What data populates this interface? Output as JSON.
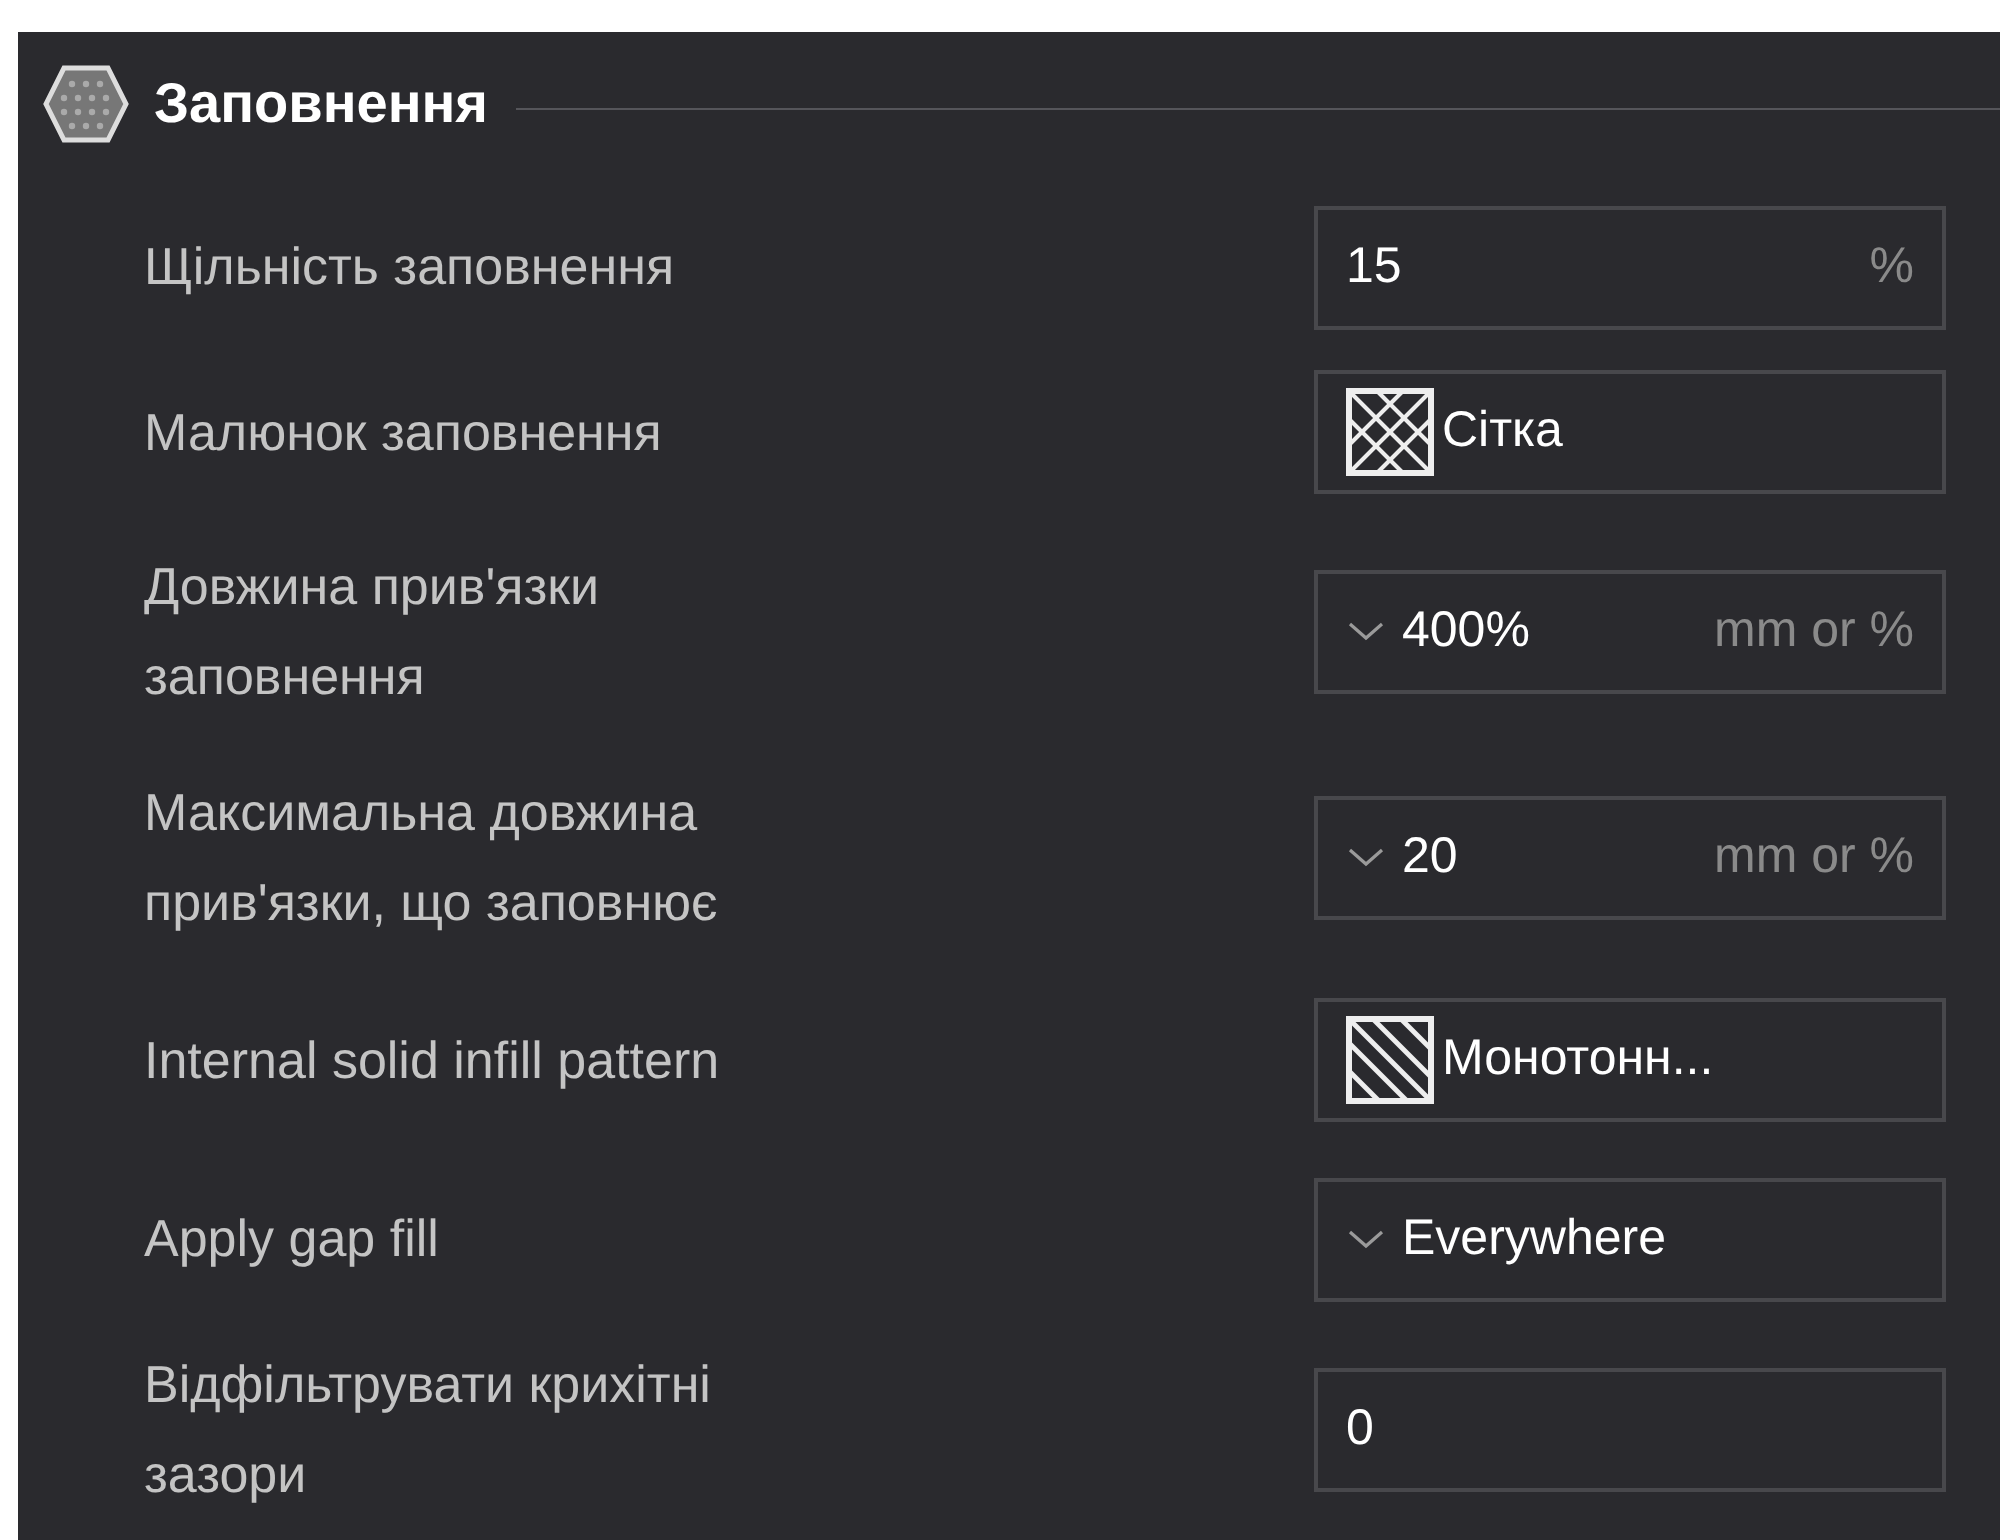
{
  "section": {
    "title": "Заповнення"
  },
  "rows": [
    {
      "label": "Щільність заповнення",
      "kind": "number",
      "value": "15",
      "unit": "%"
    },
    {
      "label": "Малюнок заповнення",
      "kind": "grid",
      "value": "Сітка"
    },
    {
      "label": "Довжина прив'язки\nзаповнення",
      "kind": "combo",
      "value": "400%",
      "unit": "mm or %"
    },
    {
      "label": "Максимальна довжина\nприв'язки, що заповнює",
      "kind": "combo",
      "value": "20",
      "unit": "mm or %"
    },
    {
      "label": "Internal solid infill pattern",
      "kind": "lines",
      "value": "Монотонн..."
    },
    {
      "label": "Apply gap fill",
      "kind": "select",
      "value": "Everywhere"
    },
    {
      "label": "Відфільтрувати крихітні\nзазори",
      "kind": "number",
      "value": "0"
    }
  ]
}
